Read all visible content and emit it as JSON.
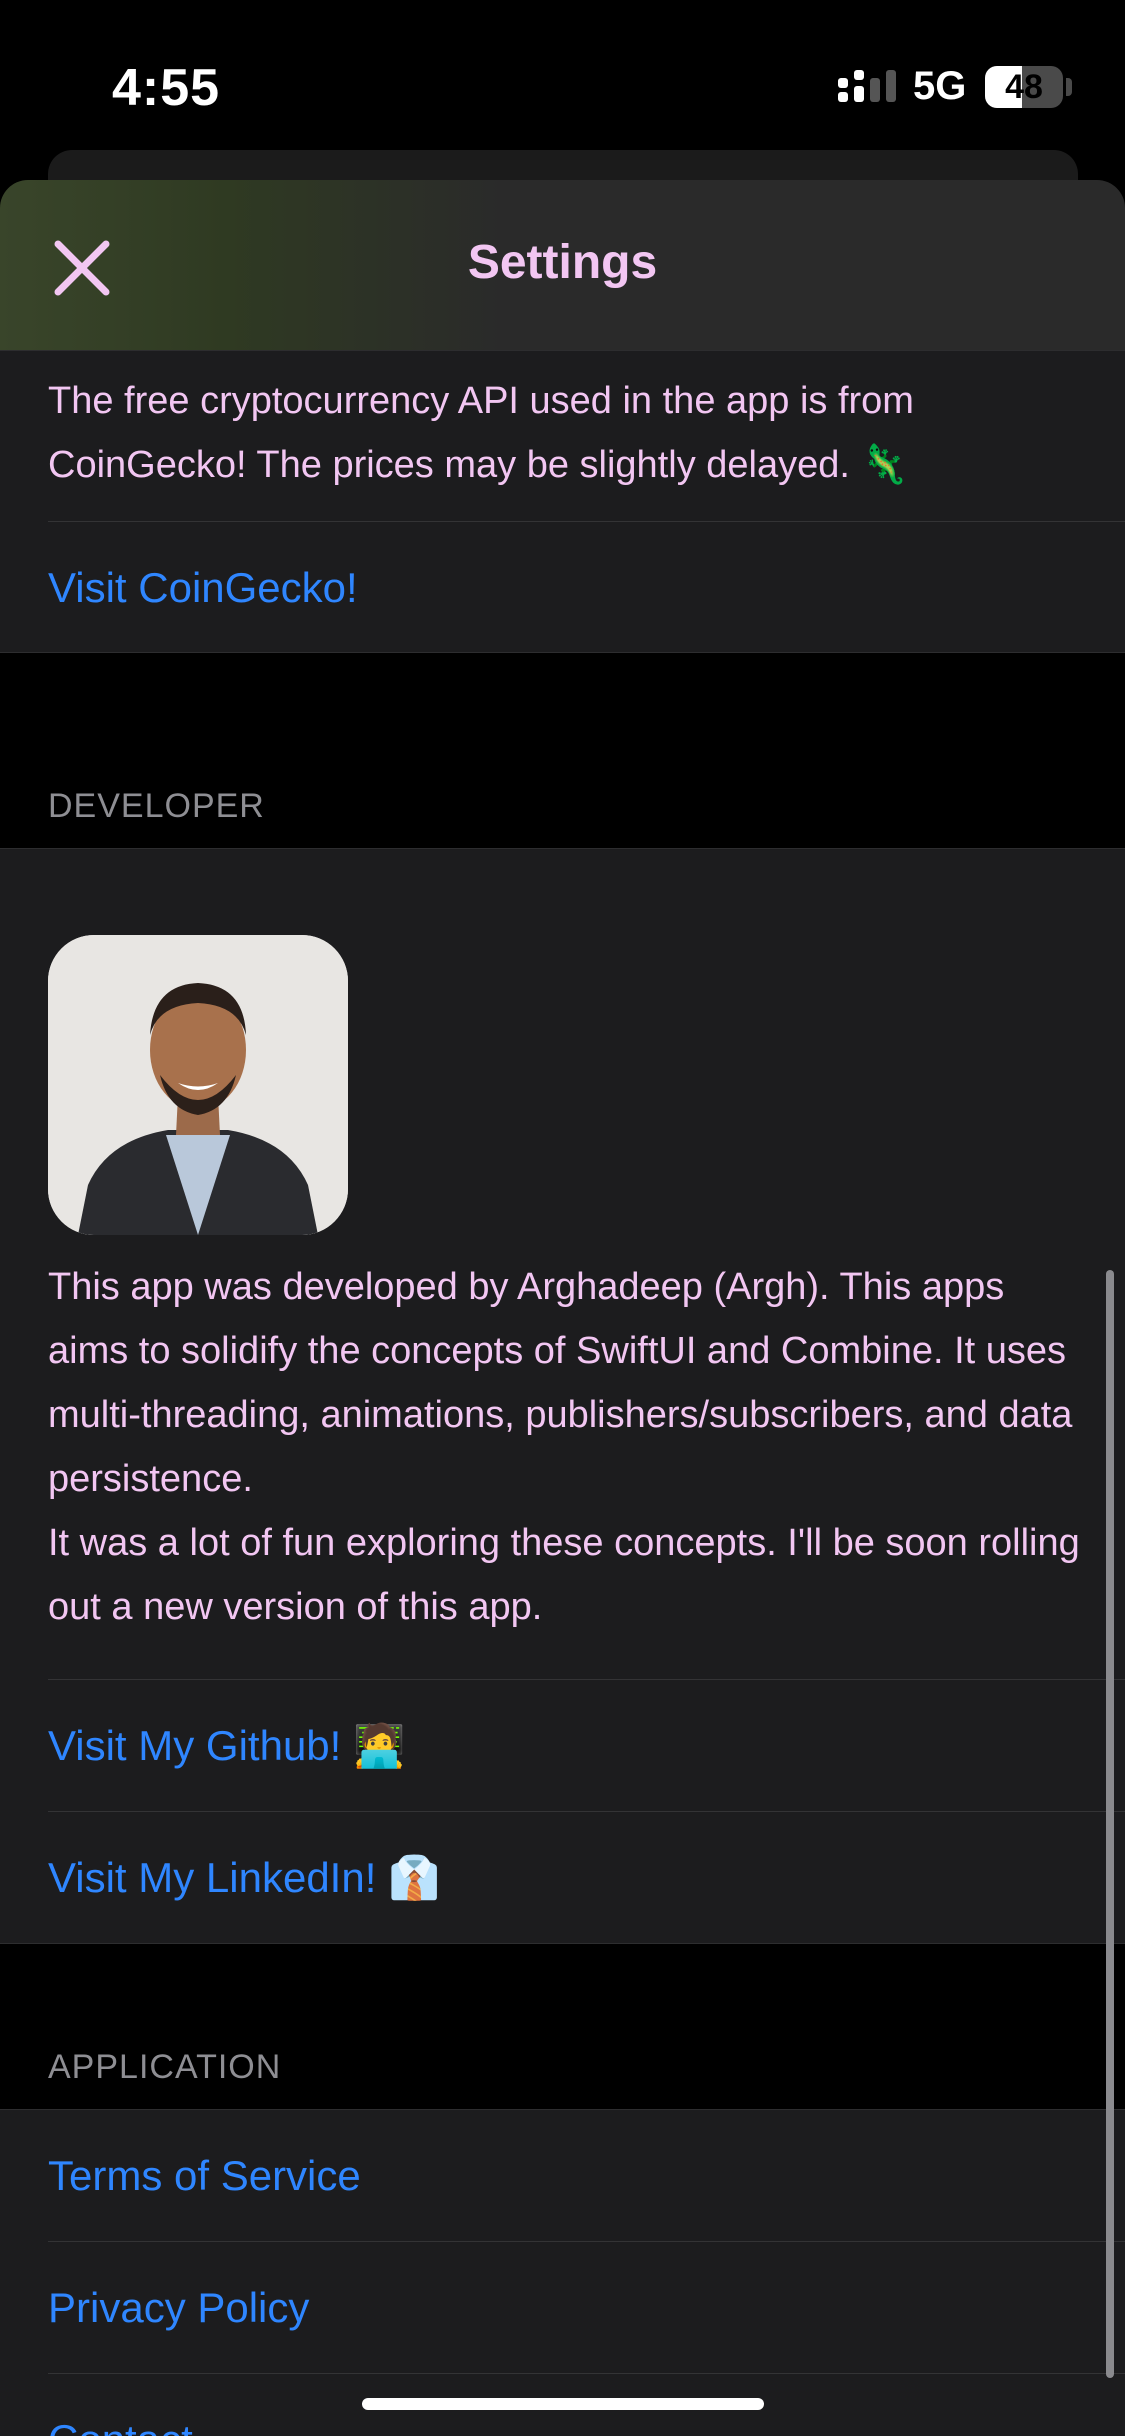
{
  "status_bar": {
    "time": "4:55",
    "network": "5G",
    "battery": "48",
    "battery_level": 0.48
  },
  "nav": {
    "title": "Settings",
    "close_icon": "close-icon"
  },
  "coingecko": {
    "description": "The free cryptocurrency API used in the app is from CoinGecko! The prices may be slightly delayed. 🦎",
    "link": "Visit CoinGecko!"
  },
  "developer": {
    "header": "DEVELOPER",
    "description_1": "This app was developed by Arghadeep (Argh). This apps aims to solidify the concepts of SwiftUI and Combine. It uses multi-threading, animations, publishers/subscribers, and data persistence.",
    "description_2": "It was a lot of fun exploring these concepts. I'll be soon rolling out a new version of this app.",
    "github_link": "Visit My Github! 🧑‍💻",
    "linkedin_link": "Visit My LinkedIn! 👔"
  },
  "application": {
    "header": "APPLICATION",
    "links": [
      "Terms of Service",
      "Privacy Policy",
      "Contact"
    ]
  },
  "colors": {
    "accent": "#2f86ff",
    "text": "#f2c6f2",
    "background": "#000000",
    "cell": "#1c1c1e"
  }
}
